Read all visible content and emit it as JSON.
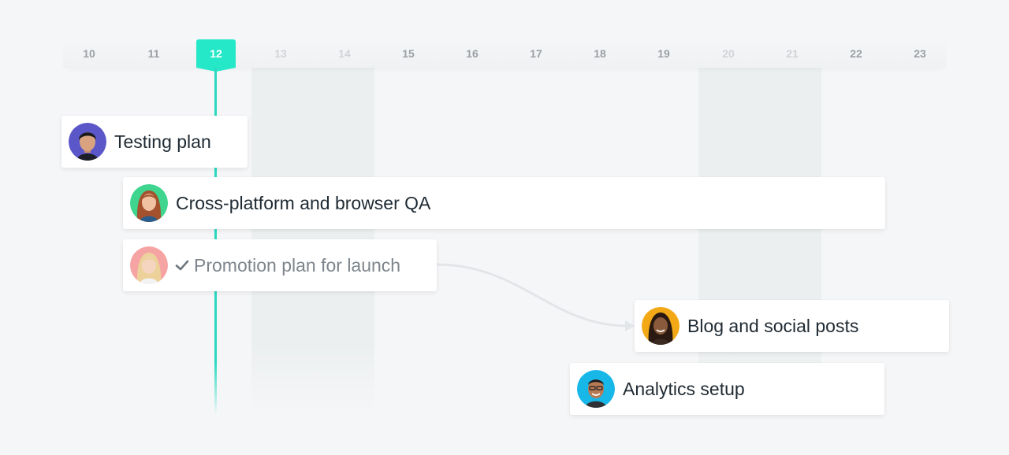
{
  "timeline": {
    "days": [
      {
        "label": "10",
        "state": "normal"
      },
      {
        "label": "11",
        "state": "normal"
      },
      {
        "label": "12",
        "state": "today"
      },
      {
        "label": "13",
        "state": "weekend"
      },
      {
        "label": "14",
        "state": "weekend"
      },
      {
        "label": "15",
        "state": "normal"
      },
      {
        "label": "16",
        "state": "normal"
      },
      {
        "label": "17",
        "state": "normal"
      },
      {
        "label": "18",
        "state": "normal"
      },
      {
        "label": "19",
        "state": "normal"
      },
      {
        "label": "20",
        "state": "weekend"
      },
      {
        "label": "21",
        "state": "weekend"
      },
      {
        "label": "22",
        "state": "normal"
      },
      {
        "label": "23",
        "state": "normal"
      }
    ],
    "accent_color": "#25e8c8"
  },
  "tasks": [
    {
      "label": "Testing plan",
      "completed": false,
      "avatar": "avatar-purple"
    },
    {
      "label": "Cross-platform and browser QA",
      "completed": false,
      "avatar": "avatar-green"
    },
    {
      "label": "Promotion plan for launch",
      "completed": true,
      "avatar": "avatar-pink"
    },
    {
      "label": "Blog and social posts",
      "completed": false,
      "avatar": "avatar-orange"
    },
    {
      "label": "Analytics setup",
      "completed": false,
      "avatar": "avatar-blue"
    }
  ],
  "icons": {
    "completed": "check-icon",
    "dependency": "dependency-arrow-icon"
  }
}
